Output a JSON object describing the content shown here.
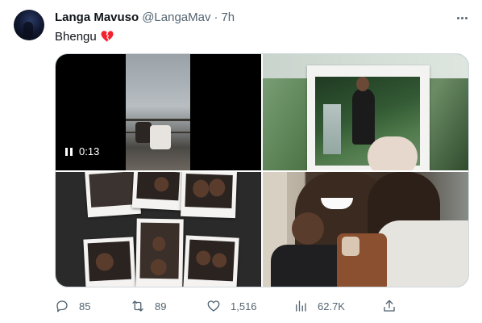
{
  "tweet": {
    "author_name": "Langa Mavuso",
    "handle": "@LangaMav",
    "separator": "·",
    "time": "7h",
    "text": "Bhengu",
    "emoji_icon": "broken-heart-icon"
  },
  "video": {
    "duration": "0:13",
    "control_icon": "pause-icon"
  },
  "actions": {
    "replies": "85",
    "retweets": "89",
    "likes": "1,516",
    "views": "62.7K"
  },
  "colors": {
    "text_primary": "#0f1419",
    "text_secondary": "#536471",
    "border": "#cfd9de",
    "heart": "#f4212e"
  }
}
